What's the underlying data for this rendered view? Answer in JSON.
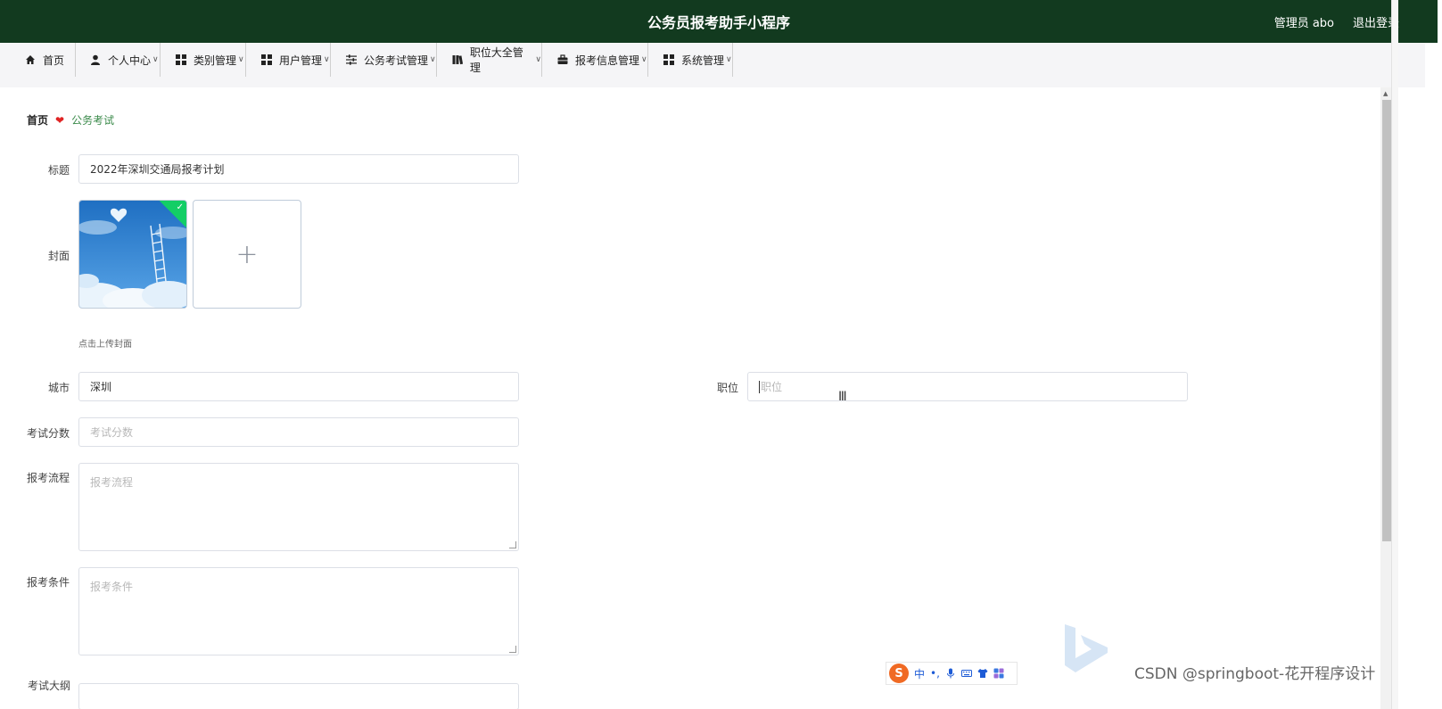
{
  "header": {
    "title": "公务员报考助手小程序",
    "user": "管理员 abo",
    "logout": "退出登录"
  },
  "nav": {
    "items": [
      {
        "label": "首页",
        "icon": "home-icon",
        "dropdown": false
      },
      {
        "label": "个人中心",
        "icon": "user-icon",
        "dropdown": true
      },
      {
        "label": "类别管理",
        "icon": "grid-icon",
        "dropdown": true
      },
      {
        "label": "用户管理",
        "icon": "grid-icon",
        "dropdown": true
      },
      {
        "label": "公务考试管理",
        "icon": "sliders-icon",
        "dropdown": true
      },
      {
        "label": "职位大全管理",
        "icon": "book-icon",
        "dropdown": true
      },
      {
        "label": "报考信息管理",
        "icon": "briefcase-icon",
        "dropdown": true
      },
      {
        "label": "系统管理",
        "icon": "grid-icon",
        "dropdown": true
      }
    ]
  },
  "breadcrumb": {
    "home": "首页",
    "current": "公务考试"
  },
  "form": {
    "title": {
      "label": "标题",
      "value": "2022年深圳交通局报考计划"
    },
    "cover": {
      "label": "封面",
      "hint": "点击上传封面"
    },
    "city": {
      "label": "城市",
      "value": "深圳"
    },
    "position": {
      "label": "职位",
      "placeholder": "职位"
    },
    "score": {
      "label": "考试分数",
      "placeholder": "考试分数"
    },
    "process": {
      "label": "报考流程",
      "placeholder": "报考流程"
    },
    "conditions": {
      "label": "报考条件",
      "placeholder": "报考条件"
    },
    "outline": {
      "label": "考试大纲"
    }
  },
  "ime": {
    "mode": "中"
  },
  "watermark": "CSDN @springboot-花开程序设计",
  "colors": {
    "header_bg": "#123a1f",
    "breadcrumb_current": "#3a8a4a",
    "heart": "#e02424",
    "upload_badge": "#13ce66"
  }
}
